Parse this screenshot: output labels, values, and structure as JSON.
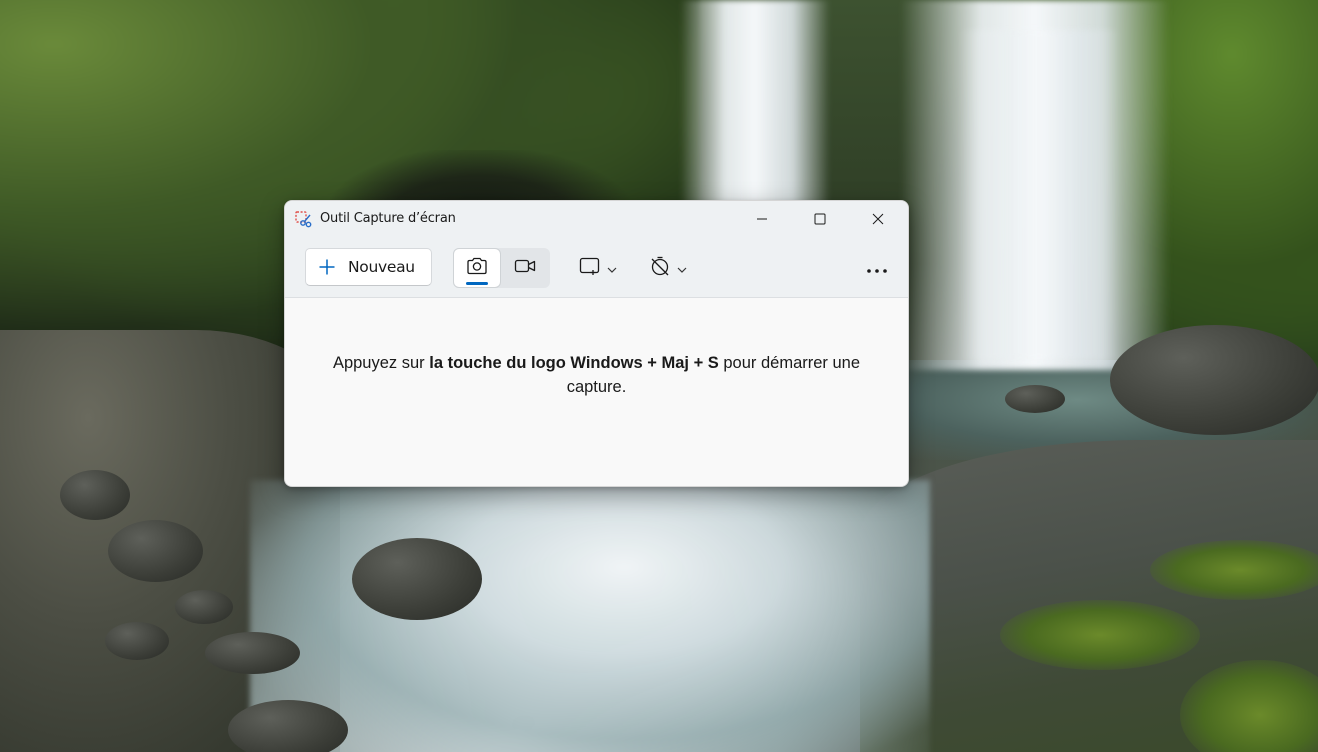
{
  "window": {
    "title": "Outil Capture d’écran",
    "app_icon": "snipping-tool-icon"
  },
  "caption_buttons": {
    "minimize_icon": "minimize-icon",
    "maximize_icon": "maximize-icon",
    "close_icon": "close-icon"
  },
  "toolbar": {
    "new_label": "Nouveau",
    "new_icon": "plus-icon",
    "mode": {
      "selected": "screenshot",
      "options": [
        {
          "id": "screenshot",
          "icon": "camera-icon"
        },
        {
          "id": "record",
          "icon": "video-camera-icon"
        }
      ]
    },
    "snip_shape_icon": "rectangle-snip-icon",
    "timer_icon": "no-delay-timer-icon",
    "more_icon": "more-ellipsis-icon"
  },
  "content": {
    "hint_before": "Appuyez sur ",
    "hint_bold": "la touche du logo Windows + Maj + S",
    "hint_after": " pour démarrer une capture."
  },
  "colors": {
    "accent": "#0067c0",
    "window_bg": "#f3f3f3",
    "content_bg": "#f9f9f9"
  }
}
